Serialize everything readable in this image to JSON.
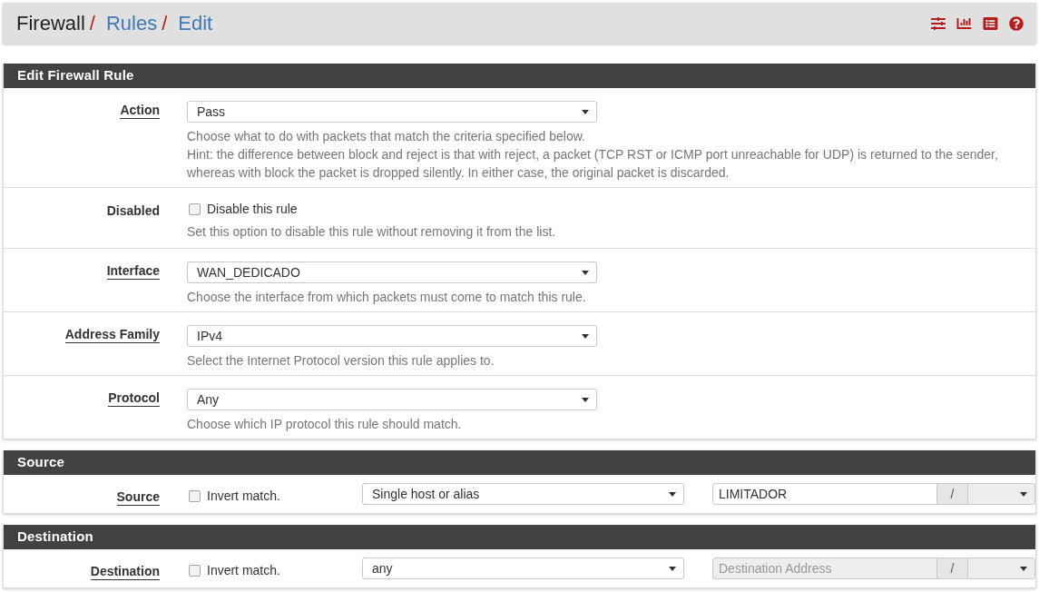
{
  "breadcrumb": [
    {
      "label": "Firewall",
      "kind": "text",
      "separator": "/"
    },
    {
      "label": "Rules",
      "kind": "link",
      "separator": "/"
    },
    {
      "label": "Edit",
      "kind": "link"
    }
  ],
  "panels": [
    {
      "title": "Edit Firewall Rule",
      "rows": [
        {
          "kind": "select",
          "label": "Action",
          "required": true,
          "value": "Pass",
          "help": [
            "Choose what to do with packets that match the criteria specified below.",
            "Hint: the difference between block and reject is that with reject, a packet (TCP RST or ICMP port unreachable for UDP) is returned to the sender, whereas with block the packet is dropped silently. In either case, the original packet is discarded."
          ]
        },
        {
          "kind": "checkbox",
          "label": "Disabled",
          "required": false,
          "checkbox": {
            "label": "Disable this rule",
            "checked": false
          },
          "help": [
            "Set this option to disable this rule without removing it from the list."
          ]
        },
        {
          "kind": "select",
          "label": "Interface",
          "required": true,
          "value": "WAN_DEDICADO",
          "help": [
            "Choose the interface from which packets must come to match this rule."
          ]
        },
        {
          "kind": "select",
          "label": "Address Family",
          "required": true,
          "value": "IPv4",
          "help": [
            "Select the Internet Protocol version this rule applies to."
          ]
        },
        {
          "kind": "select",
          "label": "Protocol",
          "required": true,
          "value": "Any",
          "help": [
            "Choose which IP protocol this rule should match."
          ]
        }
      ]
    },
    {
      "title": "Source",
      "rows": [
        {
          "kind": "address",
          "label": "Source",
          "required": true,
          "invert": {
            "label": "Invert match.",
            "checked": false
          },
          "address_type": "Single host or alias",
          "address": {
            "value": "LIMITADOR",
            "disabled": false
          },
          "mask_separator": "/",
          "mask": {
            "disabled": true
          }
        }
      ]
    },
    {
      "title": "Destination",
      "rows": [
        {
          "kind": "address",
          "label": "Destination",
          "required": true,
          "invert": {
            "label": "Invert match.",
            "checked": false
          },
          "address_type": "any",
          "address": {
            "placeholder": "Destination Address",
            "disabled": true
          },
          "mask_separator": "/",
          "mask": {
            "disabled": true
          }
        }
      ]
    }
  ]
}
